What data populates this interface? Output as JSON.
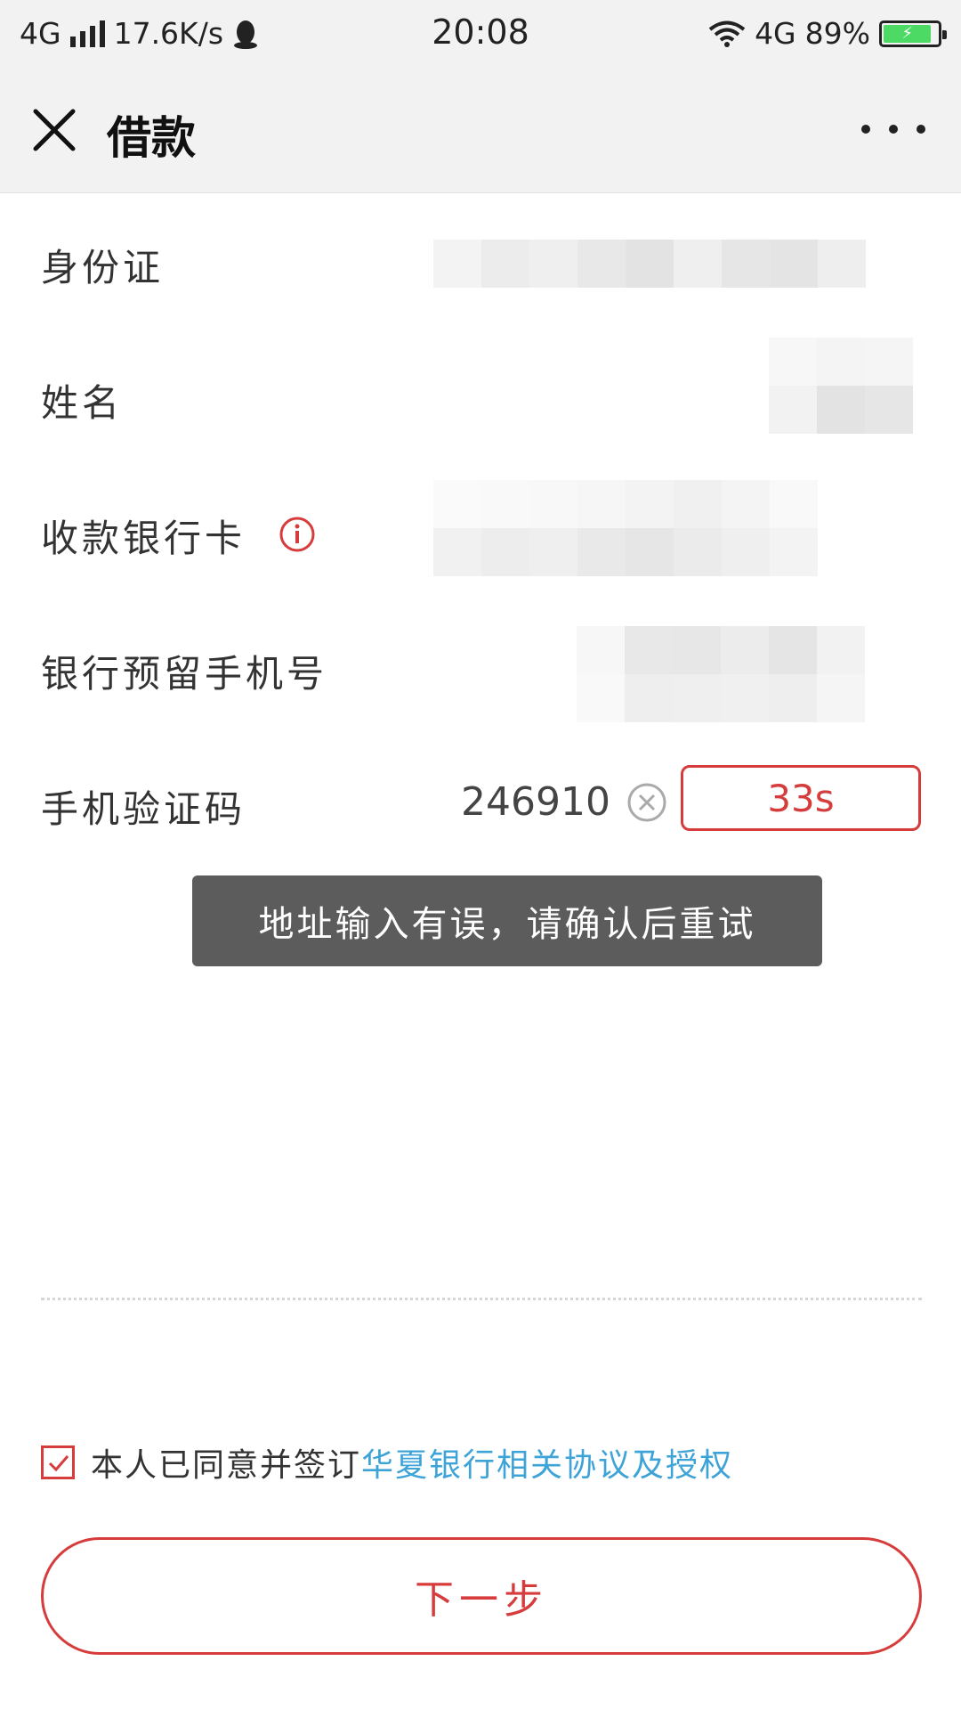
{
  "status_bar": {
    "network_left": "4G",
    "speed": "17.6K/s",
    "time": "20:08",
    "network_right": "4G",
    "battery": "89%",
    "battery_level": 0.89,
    "icons": [
      "signal-bars-icon",
      "qq-penguin-icon",
      "wifi-icon",
      "battery-icon",
      "charging-bolt-icon"
    ]
  },
  "header": {
    "title": "借款",
    "close_icon": "close-icon",
    "more_icon": "more-icon"
  },
  "form": {
    "id_card": {
      "label": "身份证"
    },
    "name": {
      "label": "姓名"
    },
    "bank_card": {
      "label": "收款银行卡",
      "icon": "info-icon"
    },
    "bank_phone": {
      "label": "银行预留手机号"
    },
    "sms_code": {
      "label": "手机验证码",
      "value": "246910",
      "timer_label": "33s"
    }
  },
  "toast": {
    "message": "地址输入有误，请确认后重试"
  },
  "agreement": {
    "checked": true,
    "text": "本人已同意并签订",
    "link_text": "华夏银行相关协议及授权"
  },
  "next_button": {
    "label": "下一步"
  },
  "colors": {
    "accent": "#d63c3c",
    "link": "#3ea3d6",
    "toast_bg": "#5c5c5c",
    "header_bg": "#f2f2f2"
  }
}
